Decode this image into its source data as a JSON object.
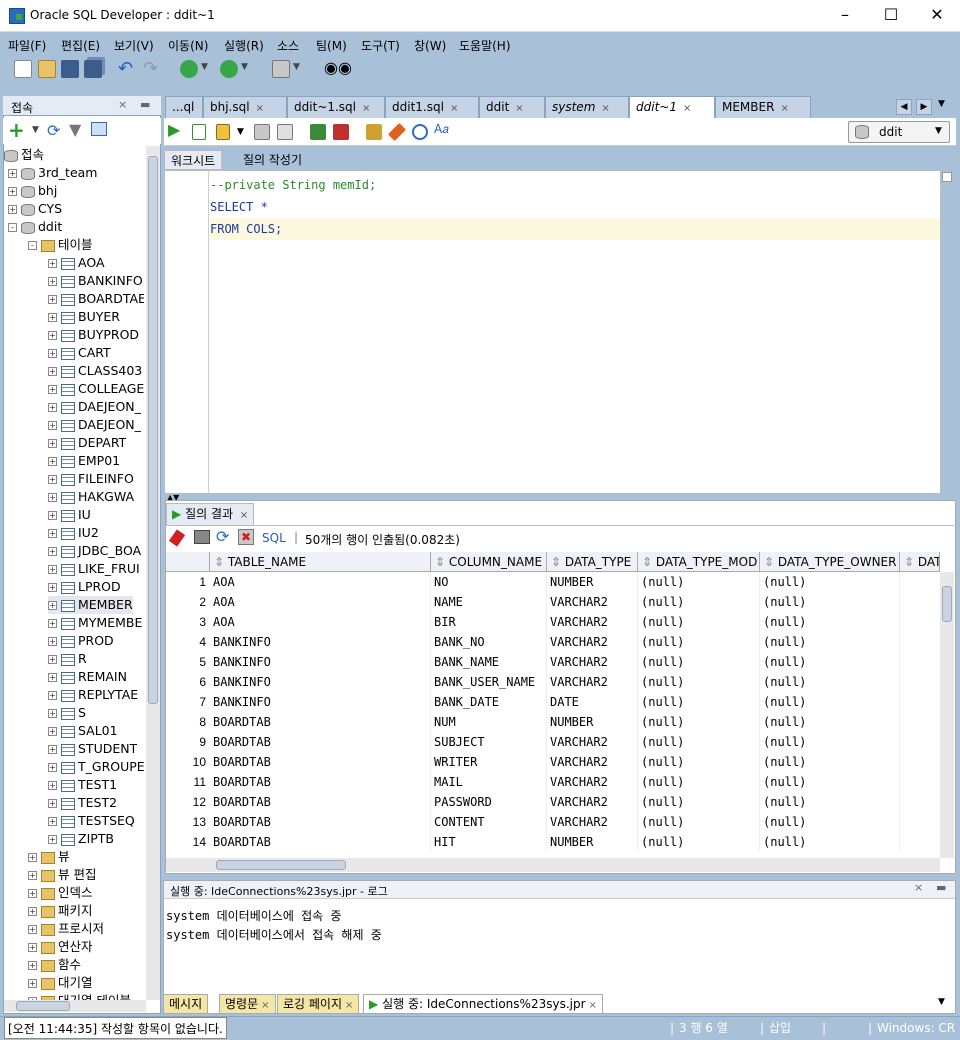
{
  "window": {
    "title": "Oracle SQL Developer : ddit~1"
  },
  "menu": [
    "파일(F)",
    "편집(E)",
    "보기(V)",
    "이동(N)",
    "실행(R)",
    "소스",
    "팀(M)",
    "도구(T)",
    "창(W)",
    "도움말(H)"
  ],
  "connections_panel": {
    "tab_label": "접속",
    "root_label": "접속",
    "connections": [
      "3rd_team",
      "bhj",
      "CYS",
      "ddit"
    ],
    "tables_folder": "테이블",
    "tables": [
      "AOA",
      "BANKINFO",
      "BOARDTAE",
      "BUYER",
      "BUYPROD",
      "CART",
      "CLASS403",
      "COLLEAGE",
      "DAEJEON_",
      "DAEJEON_",
      "DEPART",
      "EMP01",
      "FILEINFO",
      "HAKGWA",
      "IU",
      "IU2",
      "JDBC_BOA",
      "LIKE_FRUI",
      "LPROD",
      "MEMBER",
      "MYMEMBE",
      "PROD",
      "R",
      "REMAIN",
      "REPLYTAE",
      "S",
      "SAL01",
      "STUDENT",
      "T_GROUPE",
      "TEST1",
      "TEST2",
      "TESTSEQ",
      "ZIPTB"
    ],
    "folders": [
      "뷰",
      "뷰 편집",
      "인덱스",
      "패키지",
      "프로시저",
      "연산자",
      "함수",
      "대기열",
      "대기열 테이블"
    ]
  },
  "editor_tabs": [
    "...ql",
    "bhj.sql",
    "ddit~1.sql",
    "ddit1.sql",
    "ddit",
    "system",
    "ddit~1",
    "MEMBER"
  ],
  "connection_select": "ddit",
  "worksheet_tabs": [
    "워크시트",
    "질의 작성기"
  ],
  "code_lines": [
    "--private String memId;",
    "SELECT *",
    "FROM COLS;"
  ],
  "results": {
    "tab_label": "질의 결과",
    "sql_label": "SQL",
    "fetch_status": "50개의 행이 인출됨(0.082초)",
    "columns": [
      "TABLE_NAME",
      "COLUMN_NAME",
      "DATA_TYPE",
      "DATA_TYPE_MOD",
      "DATA_TYPE_OWNER",
      "DAT."
    ],
    "rows": [
      [
        "1",
        "AOA",
        "NO",
        "NUMBER",
        "(null)",
        "(null)"
      ],
      [
        "2",
        "AOA",
        "NAME",
        "VARCHAR2",
        "(null)",
        "(null)"
      ],
      [
        "3",
        "AOA",
        "BIR",
        "VARCHAR2",
        "(null)",
        "(null)"
      ],
      [
        "4",
        "BANKINFO",
        "BANK_NO",
        "VARCHAR2",
        "(null)",
        "(null)"
      ],
      [
        "5",
        "BANKINFO",
        "BANK_NAME",
        "VARCHAR2",
        "(null)",
        "(null)"
      ],
      [
        "6",
        "BANKINFO",
        "BANK_USER_NAME",
        "VARCHAR2",
        "(null)",
        "(null)"
      ],
      [
        "7",
        "BANKINFO",
        "BANK_DATE",
        "DATE",
        "(null)",
        "(null)"
      ],
      [
        "8",
        "BOARDTAB",
        "NUM",
        "NUMBER",
        "(null)",
        "(null)"
      ],
      [
        "9",
        "BOARDTAB",
        "SUBJECT",
        "VARCHAR2",
        "(null)",
        "(null)"
      ],
      [
        "10",
        "BOARDTAB",
        "WRITER",
        "VARCHAR2",
        "(null)",
        "(null)"
      ],
      [
        "11",
        "BOARDTAB",
        "MAIL",
        "VARCHAR2",
        "(null)",
        "(null)"
      ],
      [
        "12",
        "BOARDTAB",
        "PASSWORD",
        "VARCHAR2",
        "(null)",
        "(null)"
      ],
      [
        "13",
        "BOARDTAB",
        "CONTENT",
        "VARCHAR2",
        "(null)",
        "(null)"
      ],
      [
        "14",
        "BOARDTAB",
        "HIT",
        "NUMBER",
        "(null)",
        "(null)"
      ]
    ]
  },
  "log": {
    "title": "실행 중: IdeConnections%23sys.jpr - 로그",
    "lines": [
      "system 데이터베이스에 접속 중",
      "system 데이터베이스에서 접속 해제 중"
    ],
    "tabs": [
      "메시지",
      "명령문",
      "로깅 페이지",
      "실행 중: IdeConnections%23sys.jpr"
    ]
  },
  "status": {
    "left": "[오전 11:44:35] 작성할 항목이 없습니다.",
    "position": "3 행 6 열",
    "mode": "삽입",
    "os": "Windows: CR"
  }
}
